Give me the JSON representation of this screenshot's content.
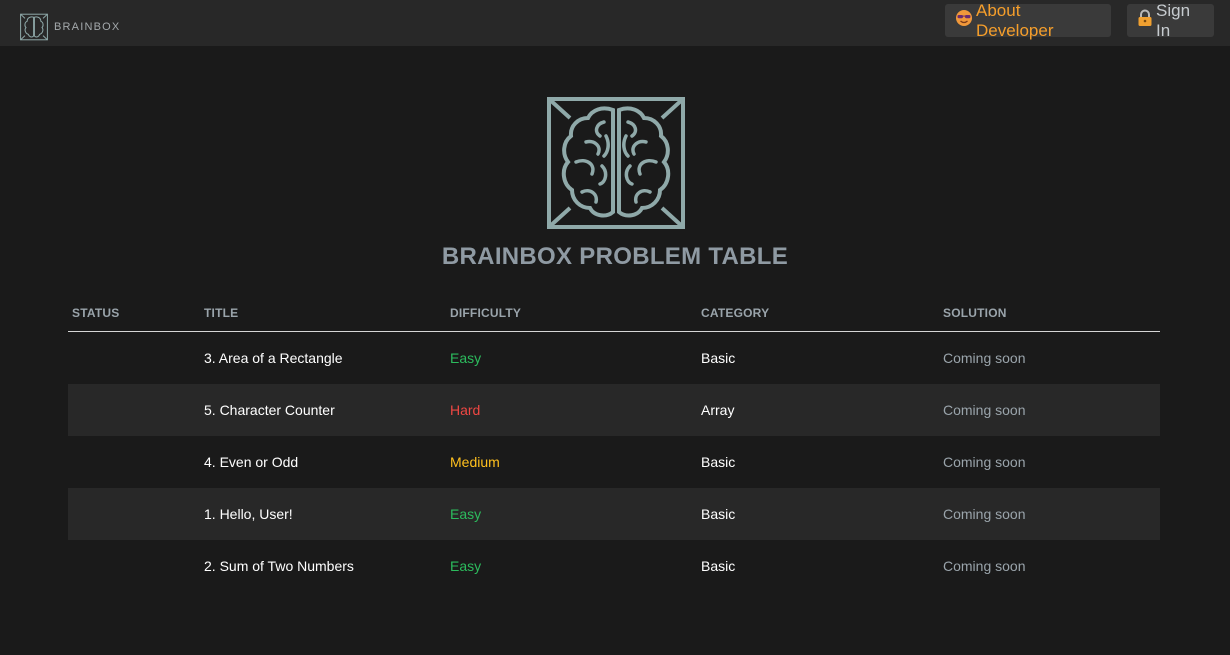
{
  "nav": {
    "brand": "BRAINBOX",
    "about_label": "About Developer",
    "signin_label": "Sign In"
  },
  "page": {
    "title": "BRAINBOX PROBLEM TABLE"
  },
  "table": {
    "headers": {
      "status": "STATUS",
      "title": "TITLE",
      "difficulty": "DIFFICULTY",
      "category": "CATEGORY",
      "solution": "SOLUTION"
    },
    "rows": [
      {
        "status": "",
        "title": "3. Area of a Rectangle",
        "difficulty": "Easy",
        "category": "Basic",
        "solution": "Coming soon"
      },
      {
        "status": "",
        "title": "5. Character Counter",
        "difficulty": "Hard",
        "category": "Array",
        "solution": "Coming soon"
      },
      {
        "status": "",
        "title": "4. Even or Odd",
        "difficulty": "Medium",
        "category": "Basic",
        "solution": "Coming soon"
      },
      {
        "status": "",
        "title": "1. Hello, User!",
        "difficulty": "Easy",
        "category": "Basic",
        "solution": "Coming soon"
      },
      {
        "status": "",
        "title": "2. Sum of Two Numbers",
        "difficulty": "Easy",
        "category": "Basic",
        "solution": "Coming soon"
      }
    ]
  },
  "colors": {
    "background": "#1a1a1a",
    "navbar": "#282828",
    "accent_orange": "#f59e2b",
    "easy": "#2cbb5d",
    "medium": "#ffc01e",
    "hard": "#ef4743",
    "logo": "#8fa9a9"
  },
  "icons": {
    "brand_logo": "brain-icon",
    "about_emoji": "sunglasses-face-icon",
    "signin_emoji": "lock-icon"
  }
}
